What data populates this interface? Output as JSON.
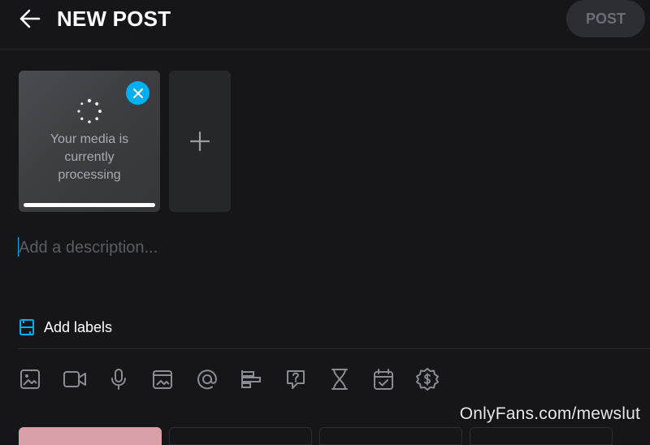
{
  "header": {
    "title": "NEW POST",
    "post_label": "POST"
  },
  "media": {
    "processing_lines": [
      "Your media is",
      "currently",
      "processing"
    ],
    "progress": 1.0
  },
  "description": {
    "placeholder": "Add a description..."
  },
  "labels": {
    "label": "Add labels"
  },
  "toolbar": {
    "icons": [
      "image-icon",
      "video-icon",
      "microphone-icon",
      "gallery-icon",
      "mention-icon",
      "poll-icon",
      "question-icon",
      "hourglass-icon",
      "schedule-icon",
      "price-icon"
    ]
  },
  "watermark": "OnlyFans.com/mewslut",
  "colors": {
    "accent": "#00aff0",
    "background": "#16161a",
    "icon": "#8a8c93"
  }
}
